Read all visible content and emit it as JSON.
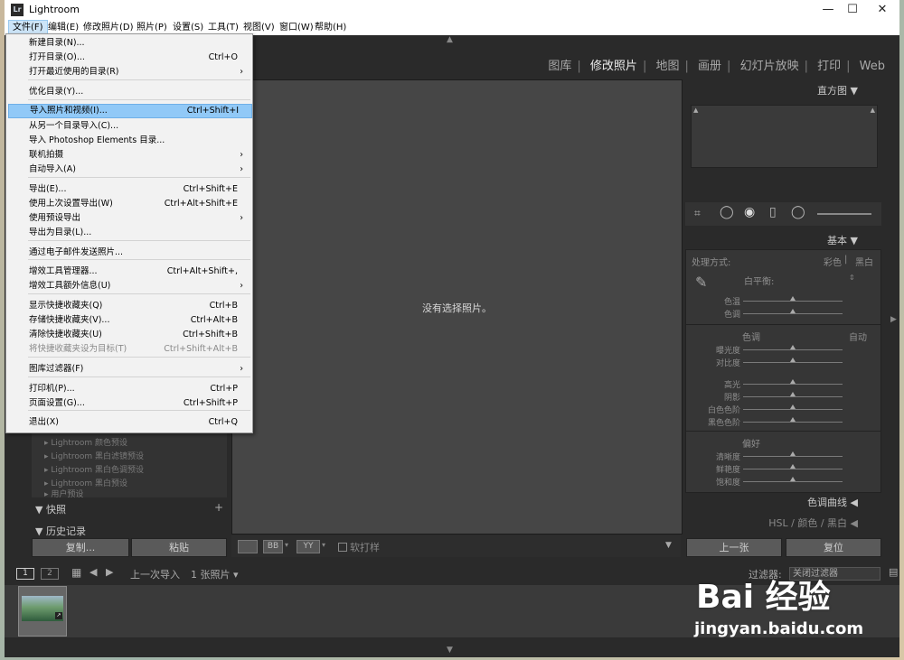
{
  "window": {
    "title": "Lightroom",
    "icon_text": "Lr",
    "minimize": "—",
    "maximize": "☐",
    "close": "✕"
  },
  "menubar": [
    "文件(F)",
    "编辑(E)",
    "修改照片(D)",
    "照片(P)",
    "设置(S)",
    "工具(T)",
    "视图(V)",
    "窗口(W)",
    "帮助(H)"
  ],
  "modules": [
    "图库",
    "修改照片",
    "地图",
    "画册",
    "幻灯片放映",
    "打印",
    "Web"
  ],
  "active_module": "修改照片",
  "center": {
    "message": "没有选择照片。"
  },
  "center_toolbar": {
    "soft_proof": "软打样",
    "yy": "YY",
    "ab": "BB"
  },
  "left_panel": {
    "presets": [
      "Lightroom 颜色预设",
      "Lightroom 黑白滤镜预设",
      "Lightroom 黑白色调预设",
      "Lightroom 黑白预设",
      "用户预设"
    ],
    "snapshots": "快照",
    "history": "历史记录",
    "copy": "复制...",
    "paste": "粘贴"
  },
  "right_panel": {
    "histogram": "直方图",
    "basic": "基本",
    "treatment": "处理方式:",
    "color": "彩色",
    "bw": "黑白",
    "white_balance": "白平衡:",
    "wb_sliders": [
      "色温",
      "色调"
    ],
    "tone": "色调",
    "auto": "自动",
    "tone_sliders1": [
      "曝光度",
      "对比度"
    ],
    "tone_sliders2": [
      "高光",
      "阴影",
      "白色色阶",
      "黑色色阶"
    ],
    "presence": "偏好",
    "presence_sliders": [
      "清晰度",
      "鲜艳度",
      "饱和度"
    ],
    "tone_curve": "色调曲线",
    "hsl": "HSL / 颜色 / 黑白",
    "prev": "上一张",
    "reset": "复位"
  },
  "filmstrip": {
    "page1": "1",
    "page2": "2",
    "source": "上一次导入",
    "count": "1 张照片",
    "filter_label": "过滤器:",
    "filter_value": "关闭过滤器"
  },
  "file_menu": [
    {
      "label": "新建目录(N)...",
      "shortcut": "",
      "sub": false
    },
    {
      "label": "打开目录(O)...",
      "shortcut": "Ctrl+O",
      "sub": false
    },
    {
      "label": "打开最近使用的目录(R)",
      "shortcut": "",
      "sub": true
    },
    {
      "label": "优化目录(Y)...",
      "shortcut": "",
      "sub": false
    },
    {
      "label": "导入照片和视频(I)...",
      "shortcut": "Ctrl+Shift+I",
      "sub": false,
      "highlight": true
    },
    {
      "label": "从另一个目录导入(C)...",
      "shortcut": "",
      "sub": false
    },
    {
      "label": "导入 Photoshop Elements 目录...",
      "shortcut": "",
      "sub": false
    },
    {
      "label": "联机拍摄",
      "shortcut": "",
      "sub": true
    },
    {
      "label": "自动导入(A)",
      "shortcut": "",
      "sub": true
    },
    {
      "label": "导出(E)...",
      "shortcut": "Ctrl+Shift+E",
      "sub": false
    },
    {
      "label": "使用上次设置导出(W)",
      "shortcut": "Ctrl+Alt+Shift+E",
      "sub": false
    },
    {
      "label": "使用预设导出",
      "shortcut": "",
      "sub": true
    },
    {
      "label": "导出为目录(L)...",
      "shortcut": "",
      "sub": false
    },
    {
      "label": "通过电子邮件发送照片...",
      "shortcut": "",
      "sub": false
    },
    {
      "label": "增效工具管理器...",
      "shortcut": "Ctrl+Alt+Shift+,",
      "sub": false
    },
    {
      "label": "增效工具额外信息(U)",
      "shortcut": "",
      "sub": true
    },
    {
      "label": "显示快捷收藏夹(Q)",
      "shortcut": "Ctrl+B",
      "sub": false
    },
    {
      "label": "存储快捷收藏夹(V)...",
      "shortcut": "Ctrl+Alt+B",
      "sub": false
    },
    {
      "label": "清除快捷收藏夹(U)",
      "shortcut": "Ctrl+Shift+B",
      "sub": false
    },
    {
      "label": "将快捷收藏夹设为目标(T)",
      "shortcut": "Ctrl+Shift+Alt+B",
      "sub": false,
      "disabled": true
    },
    {
      "label": "图库过滤器(F)",
      "shortcut": "",
      "sub": true
    },
    {
      "label": "打印机(P)...",
      "shortcut": "Ctrl+P",
      "sub": false
    },
    {
      "label": "页面设置(G)...",
      "shortcut": "Ctrl+Shift+P",
      "sub": false
    },
    {
      "label": "退出(X)",
      "shortcut": "Ctrl+Q",
      "sub": false
    }
  ],
  "watermark": {
    "brand": "Bai 经验",
    "url": "jingyan.baidu.com"
  }
}
